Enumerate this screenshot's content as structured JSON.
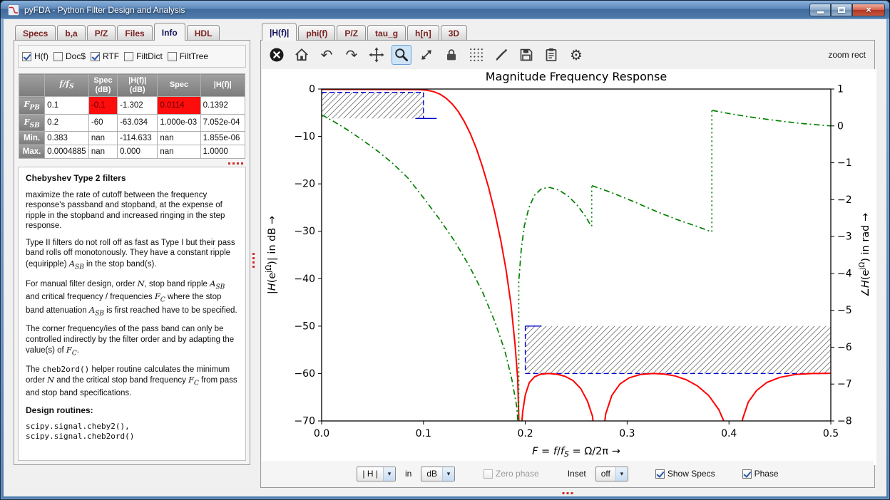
{
  "window": {
    "title": "pyFDA - Python Filter Design and Analysis",
    "buttons": [
      "minimize",
      "maximize",
      "close"
    ]
  },
  "left_panel": {
    "tabs": [
      {
        "label": "Specs",
        "active": false
      },
      {
        "label": "b,a",
        "active": false
      },
      {
        "label": "P/Z",
        "active": false
      },
      {
        "label": "Files",
        "active": false
      },
      {
        "label": "Info",
        "active": true
      },
      {
        "label": "HDL",
        "active": false
      }
    ],
    "checkboxes": [
      {
        "label": "H(f)",
        "checked": true,
        "enabled": true
      },
      {
        "label": "Doc$",
        "checked": false,
        "enabled": true
      },
      {
        "label": "RTF",
        "checked": true,
        "enabled": true
      },
      {
        "label": "FiltDict",
        "checked": false,
        "enabled": true
      },
      {
        "label": "FiltTree",
        "checked": false,
        "enabled": true
      }
    ],
    "table": {
      "headers": [
        {
          "segs": [
            [
              "",
              ""
            ]
          ]
        },
        {
          "segs": [
            [
              "i",
              "f/f"
            ],
            [
              "subi",
              "S"
            ]
          ]
        },
        {
          "segs": [
            [
              "",
              "Spec\n(dB)"
            ]
          ]
        },
        {
          "segs": [
            [
              "",
              "|H(f)|\n(dB)"
            ]
          ]
        },
        {
          "segs": [
            [
              "",
              "Spec"
            ]
          ]
        },
        {
          "segs": [
            [
              "",
              "|H(f)|"
            ]
          ]
        }
      ],
      "rows": [
        {
          "label": {
            "segs": [
              [
                "i",
                "F"
              ],
              [
                "subi",
                "PB"
              ]
            ]
          },
          "cells": [
            {
              "v": "0.1"
            },
            {
              "v": "-0.1",
              "alert": true
            },
            {
              "v": "-1.302"
            },
            {
              "v": "0.0114",
              "alert": true
            },
            {
              "v": "0.1392"
            }
          ]
        },
        {
          "label": {
            "segs": [
              [
                "i",
                "F"
              ],
              [
                "subi",
                "SB"
              ]
            ]
          },
          "cells": [
            {
              "v": "0.2"
            },
            {
              "v": "-60"
            },
            {
              "v": "-63.034"
            },
            {
              "v": "1.000e-03"
            },
            {
              "v": "7.052e-04"
            }
          ]
        },
        {
          "label": {
            "segs": [
              [
                "",
                "Min."
              ]
            ]
          },
          "cells": [
            {
              "v": "0.383"
            },
            {
              "v": "nan"
            },
            {
              "v": "-114.633"
            },
            {
              "v": "nan"
            },
            {
              "v": "1.855e-06"
            }
          ]
        },
        {
          "label": {
            "segs": [
              [
                "",
                "Max."
              ]
            ]
          },
          "cells": [
            {
              "v": "0.0004885"
            },
            {
              "v": "nan"
            },
            {
              "v": "0.000"
            },
            {
              "v": "nan"
            },
            {
              "v": "1.0000"
            }
          ]
        }
      ]
    },
    "info": {
      "heading": "Chebyshev Type 2 filters",
      "paragraphs": [
        [
          [
            "",
            "maximize the rate of cutoff between the frequency response's passband and stopband, at the expense of ripple in the stopband and increased ringing in the step response."
          ]
        ],
        [
          [
            "",
            "Type II filters do not roll off as fast as Type I but their pass band rolls off monotonously. They have a constant ripple (equiripple) "
          ],
          [
            "i",
            "A"
          ],
          [
            "subi",
            "SB"
          ],
          [
            "",
            " in the stop band(s)."
          ]
        ],
        [
          [
            "",
            "For manual filter design, order "
          ],
          [
            "i",
            "N"
          ],
          [
            "",
            ", stop band ripple "
          ],
          [
            "i",
            "A"
          ],
          [
            "subi",
            "SB"
          ],
          [
            "",
            " and critical frequency / frequencies "
          ],
          [
            "i",
            "F"
          ],
          [
            "subi",
            "C"
          ],
          [
            "",
            " where the stop band attenuation "
          ],
          [
            "i",
            "A"
          ],
          [
            "subi",
            "SB"
          ],
          [
            "",
            " is first reached have to be specified."
          ]
        ],
        [
          [
            "",
            "The corner frequency/ies of the pass band can only be controlled indirectly by the filter order and by adapting the value(s) of "
          ],
          [
            "i",
            "F"
          ],
          [
            "subi",
            "C"
          ],
          [
            "",
            "."
          ]
        ],
        [
          [
            "",
            "The "
          ],
          [
            "code",
            "cheb2ord()"
          ],
          [
            "",
            " helper routine calculates the minimum order "
          ],
          [
            "i",
            "N"
          ],
          [
            "",
            " and the critical stop band frequency "
          ],
          [
            "i",
            "F"
          ],
          [
            "subi",
            "C"
          ],
          [
            "",
            " from pass and stop band specifications."
          ]
        ]
      ],
      "design_heading": "Design routines:",
      "code_lines": [
        "scipy.signal.cheby2(),",
        "scipy.signal.cheb2ord()"
      ]
    }
  },
  "right_panel": {
    "tabs": [
      {
        "label": "|H(f)|",
        "active": true
      },
      {
        "label": "phi(f)",
        "active": false
      },
      {
        "label": "P/Z",
        "active": false
      },
      {
        "label": "tau_g",
        "active": false
      },
      {
        "label": "h[n]",
        "active": false
      },
      {
        "label": "3D",
        "active": false
      }
    ],
    "toolbar": {
      "icons": [
        {
          "name": "close",
          "selected": false
        },
        {
          "name": "home",
          "selected": false
        },
        {
          "name": "undo",
          "selected": false
        },
        {
          "name": "redo",
          "selected": false
        },
        {
          "name": "pan",
          "selected": false
        },
        {
          "name": "zoom",
          "selected": true
        },
        {
          "name": "full-extent",
          "selected": false
        },
        {
          "name": "lock-zoom",
          "selected": false
        },
        {
          "name": "grid",
          "selected": false
        },
        {
          "name": "edit-axes",
          "selected": false
        },
        {
          "name": "save",
          "selected": false
        },
        {
          "name": "copy-clipboard",
          "selected": false
        },
        {
          "name": "settings",
          "selected": false
        }
      ],
      "mode_label": "zoom rect"
    },
    "controls": {
      "quantity": {
        "value": "| H |"
      },
      "in_label": "in",
      "unit": {
        "value": "dB"
      },
      "zero_phase": {
        "label": "Zero phase",
        "checked": false,
        "enabled": false
      },
      "inset_label": "Inset",
      "inset": {
        "value": "off"
      },
      "show_specs": {
        "label": "Show Specs",
        "checked": true,
        "enabled": true
      },
      "phase": {
        "label": "Phase",
        "checked": true,
        "enabled": true
      }
    }
  },
  "chart_data": {
    "type": "line",
    "title": "Magnitude Frequency Response",
    "xlim": [
      0,
      0.5
    ],
    "ylim_left_dB": [
      -70,
      0
    ],
    "ylim_right_rad": [
      -8,
      1
    ],
    "grid": false,
    "xtick_values": [
      0,
      0.1,
      0.2,
      0.3,
      0.4,
      0.5
    ],
    "xtick_labels": [
      "0.0",
      "0.1",
      "0.2",
      "0.3",
      "0.4",
      "0.5"
    ],
    "yticks_left": {
      "values": [
        0,
        -10,
        -20,
        -30,
        -40,
        -50,
        -60,
        -70
      ],
      "labels": [
        "0",
        "−10",
        "−20",
        "−30",
        "−40",
        "−50",
        "−60",
        "−70"
      ]
    },
    "yticks_right": {
      "values": [
        1,
        0,
        -1,
        -2,
        -3,
        -4,
        -5,
        -6,
        -7,
        -8
      ],
      "labels": [
        "1",
        "0",
        "−1",
        "−2",
        "−3",
        "−4",
        "−5",
        "−6",
        "−7",
        "−8"
      ]
    },
    "xlabel_segs": [
      [
        "i",
        "F"
      ],
      [
        "",
        " = "
      ],
      [
        "i",
        "f"
      ],
      [
        "",
        "/"
      ],
      [
        "i",
        "f"
      ],
      [
        "subi",
        "S"
      ],
      [
        "",
        " = Ω/2π →"
      ]
    ],
    "ylabel_left_segs": [
      [
        "",
        "|"
      ],
      [
        "i",
        "H"
      ],
      [
        "",
        "(e"
      ],
      [
        "sup",
        "jΩ"
      ],
      [
        "",
        ")| in dB →"
      ]
    ],
    "ylabel_right_segs": [
      [
        "",
        "∠"
      ],
      [
        "i",
        "H"
      ],
      [
        "",
        "(e"
      ],
      [
        "sup",
        "jΩ"
      ],
      [
        "",
        ") in rad →"
      ]
    ],
    "series": [
      {
        "name": "magnitude_dB",
        "axis": "left",
        "color": "#ff0000",
        "width": 2,
        "dash": "",
        "segments": [
          [
            [
              0.0,
              -0.08
            ],
            [
              0.03,
              -0.08
            ],
            [
              0.06,
              -0.09
            ],
            [
              0.085,
              -0.1
            ],
            [
              0.095,
              -0.12
            ],
            [
              0.103,
              -0.22
            ],
            [
              0.11,
              -0.55
            ],
            [
              0.116,
              -1.05
            ],
            [
              0.122,
              -1.9
            ],
            [
              0.128,
              -3.1
            ],
            [
              0.134,
              -4.7
            ],
            [
              0.14,
              -6.8
            ],
            [
              0.146,
              -9.4
            ],
            [
              0.152,
              -12.6
            ],
            [
              0.158,
              -16.4
            ],
            [
              0.164,
              -20.8
            ],
            [
              0.17,
              -26.0
            ],
            [
              0.176,
              -32.0
            ],
            [
              0.181,
              -38.0
            ],
            [
              0.186,
              -45.5
            ],
            [
              0.19,
              -54.0
            ],
            [
              0.1925,
              -61.0
            ],
            [
              0.1945,
              -76.0
            ],
            [
              0.1975,
              -68.0
            ],
            [
              0.2,
              -64.5
            ],
            [
              0.204,
              -61.9
            ],
            [
              0.209,
              -60.7
            ],
            [
              0.215,
              -60.15
            ],
            [
              0.223,
              -60.0
            ],
            [
              0.231,
              -60.15
            ],
            [
              0.239,
              -60.6
            ],
            [
              0.247,
              -61.5
            ],
            [
              0.2545,
              -63.2
            ],
            [
              0.261,
              -65.8
            ],
            [
              0.266,
              -69.0
            ],
            [
              0.2695,
              -76.0
            ],
            [
              0.2745,
              -76.0
            ],
            [
              0.279,
              -68.5
            ],
            [
              0.285,
              -64.6
            ],
            [
              0.293,
              -62.2
            ],
            [
              0.302,
              -60.9
            ],
            [
              0.313,
              -60.2
            ],
            [
              0.325,
              -60.0
            ],
            [
              0.336,
              -60.1
            ],
            [
              0.347,
              -60.5
            ],
            [
              0.358,
              -61.3
            ],
            [
              0.369,
              -62.6
            ],
            [
              0.38,
              -64.6
            ],
            [
              0.39,
              -67.6
            ],
            [
              0.398,
              -71.5
            ],
            [
              0.4025,
              -76.0
            ],
            [
              0.408,
              -76.0
            ],
            [
              0.4135,
              -69.5
            ],
            [
              0.419,
              -66.0
            ],
            [
              0.427,
              -63.6
            ],
            [
              0.437,
              -61.9
            ],
            [
              0.45,
              -60.8
            ],
            [
              0.465,
              -60.2
            ],
            [
              0.482,
              -60.0
            ],
            [
              0.5,
              -59.95
            ]
          ]
        ]
      },
      {
        "name": "phase_rad",
        "axis": "right",
        "color": "#008000",
        "width": 1.7,
        "dash": "8 4 2 4",
        "segments": [
          [
            [
              0.0,
              0.3
            ],
            [
              0.012,
              0.12
            ],
            [
              0.025,
              -0.1
            ],
            [
              0.04,
              -0.38
            ],
            [
              0.055,
              -0.68
            ],
            [
              0.07,
              -1.02
            ],
            [
              0.085,
              -1.42
            ],
            [
              0.1,
              -1.95
            ],
            [
              0.115,
              -2.5
            ],
            [
              0.13,
              -3.1
            ],
            [
              0.145,
              -3.8
            ],
            [
              0.158,
              -4.5
            ],
            [
              0.17,
              -5.3
            ],
            [
              0.18,
              -6.1
            ],
            [
              0.187,
              -6.9
            ],
            [
              0.1915,
              -7.6
            ],
            [
              0.1933,
              -8.2
            ]
          ],
          [
            [
              0.1938,
              -4.15
            ],
            [
              0.196,
              -3.35
            ],
            [
              0.199,
              -2.72
            ],
            [
              0.2035,
              -2.22
            ],
            [
              0.209,
              -1.88
            ],
            [
              0.216,
              -1.7
            ],
            [
              0.224,
              -1.67
            ],
            [
              0.233,
              -1.74
            ],
            [
              0.242,
              -1.9
            ],
            [
              0.251,
              -2.15
            ],
            [
              0.259,
              -2.45
            ],
            [
              0.2648,
              -2.72
            ]
          ],
          [
            [
              0.2655,
              -1.62
            ],
            [
              0.278,
              -1.74
            ],
            [
              0.292,
              -1.89
            ],
            [
              0.307,
              -2.06
            ],
            [
              0.322,
              -2.24
            ],
            [
              0.337,
              -2.41
            ],
            [
              0.352,
              -2.57
            ],
            [
              0.367,
              -2.71
            ],
            [
              0.3828,
              -2.87
            ]
          ],
          [
            [
              0.3836,
              0.42
            ],
            [
              0.4,
              0.335
            ],
            [
              0.42,
              0.245
            ],
            [
              0.445,
              0.15
            ],
            [
              0.47,
              0.07
            ],
            [
              0.5,
              0.0
            ]
          ]
        ],
        "jumps": [
          {
            "x": 0.1936,
            "y1": -8.2,
            "y2": -4.15
          },
          {
            "x": 0.2652,
            "y1": -2.72,
            "y2": -1.62
          },
          {
            "x": 0.3832,
            "y1": -2.87,
            "y2": 0.42
          }
        ]
      }
    ],
    "specs": {
      "color": "#0000cc",
      "passband": {
        "hatch": {
          "x": [
            0,
            0.1
          ],
          "y": [
            -0.7,
            -6.2
          ]
        },
        "hline": {
          "y": -0.7,
          "x": [
            0,
            0.1
          ]
        },
        "vline": {
          "x": 0.1,
          "y": [
            -0.7,
            -6.2
          ]
        },
        "stub": {
          "y": -6.2,
          "x": [
            0.092,
            0.113
          ]
        }
      },
      "stopband": {
        "hatch": {
          "x": [
            0.2,
            0.5
          ],
          "y": [
            -50,
            -60
          ]
        },
        "hline": {
          "y": -60,
          "x": [
            0.2,
            0.5
          ]
        },
        "vline": {
          "x": 0.2,
          "y": [
            -50,
            -60
          ]
        },
        "stub": {
          "y": -50,
          "x": [
            0.2,
            0.216
          ]
        }
      }
    }
  }
}
